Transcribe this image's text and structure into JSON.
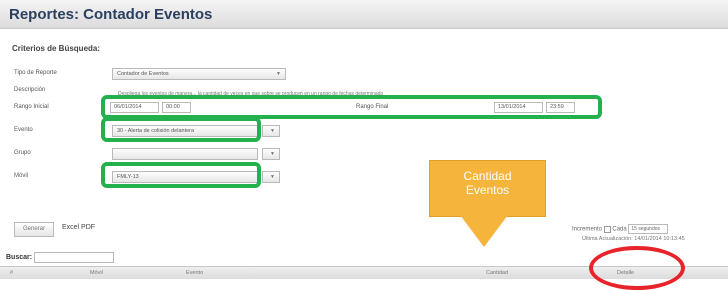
{
  "header": {
    "title": "Reportes: Contador Eventos"
  },
  "criteria": {
    "title": "Criterios de Búsqueda:",
    "tipo_reporte": {
      "label": "Tipo de Reporte",
      "value": "Contador de Eventos"
    },
    "descripcion": {
      "label": "Descripción",
      "text": "Despliega los eventos de manera... la cantidad de veces en que sobre se producen en un rango de fechas determinado"
    },
    "rango_inicial": {
      "label": "Rango Inicial",
      "date": "06/01/2014",
      "time": "00:00"
    },
    "rango_final": {
      "label": "Rango Final",
      "date": "13/01/2014",
      "time": "23:59"
    },
    "evento": {
      "label": "Evento",
      "value": "30 - Alerta de colisión delantera"
    },
    "grupo": {
      "label": "Grupo",
      "value": ""
    },
    "movil": {
      "label": "Móvil",
      "value": "FMLY-13"
    }
  },
  "actions": {
    "generar": "Generar",
    "excel": "Excel PDF",
    "auto": "Incremento",
    "cada": "Cada",
    "interval": "15 segundos",
    "updated": "Última Actualización: 14/01/2014 10:13:45"
  },
  "search": {
    "label": "Buscar:"
  },
  "table": {
    "columns": [
      "#",
      "Móvil",
      "Evento",
      "Cantidad",
      "Detalle"
    ]
  },
  "annotation": {
    "callout_line1": "Cantidad",
    "callout_line2": "Eventos"
  },
  "colors": {
    "highlight": "#22b14c",
    "callout": "#f5b43c",
    "circle": "#e8232a"
  }
}
